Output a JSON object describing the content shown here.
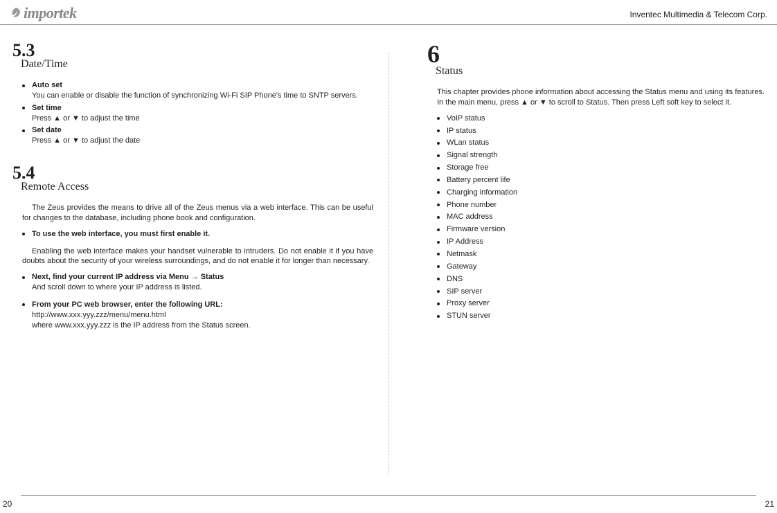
{
  "header": {
    "logo": "importek",
    "corp": "Inventec Multimedia & Telecom Corp."
  },
  "left": {
    "sec53": {
      "num": "5.3",
      "title": "Date/Time",
      "items": [
        {
          "head": "Auto set",
          "body": "You can enable or disable the function of synchronizing Wi-Fi SIP Phone's time to SNTP servers."
        },
        {
          "head": "Set time",
          "body": "Press ▲ or ▼ to adjust the time"
        },
        {
          "head": "Set date",
          "body": "Press ▲ or ▼ to adjust the date"
        }
      ]
    },
    "sec54": {
      "num": "5.4",
      "title": "Remote Access",
      "intro": "The Zeus provides the means to drive all of the Zeus menus via a web interface. This can be useful for changes to the database, including phone book and configuration.",
      "b1": "To use the web interface, you must first enable it.",
      "warn": "Enabling the web interface makes your handset vulnerable to intruders. Do not enable it if you have doubts about the security of your wireless surroundings, and do not enable it for longer than necessary.",
      "b2head": "Next, find your current IP address via Menu → Status",
      "b2body": "And scroll down to where your IP address is listed.",
      "b3head": "From your PC web browser, enter the following URL:",
      "b3body1": "http://www.xxx.yyy.zzz/menu/menu.html",
      "b3body2": "where www.xxx.yyy.zzz is the IP address from the Status screen."
    }
  },
  "right": {
    "sec6": {
      "num": "6",
      "title": "Status",
      "intro": "This chapter provides phone information about accessing the Status menu and using its features. In the main menu, press ▲ or ▼ to scroll to Status. Then press Left soft key to select it.",
      "items": [
        "VoIP status",
        "IP status",
        "WLan status",
        "Signal strength",
        "Storage free",
        "Battery percent life",
        "Charging information",
        "Phone number",
        "MAC address",
        "Firmware version",
        "IP Address",
        "Netmask",
        "Gateway",
        "DNS",
        "SIP server",
        "Proxy server",
        "STUN server"
      ]
    }
  },
  "footer": {
    "left": "20",
    "right": "21"
  }
}
